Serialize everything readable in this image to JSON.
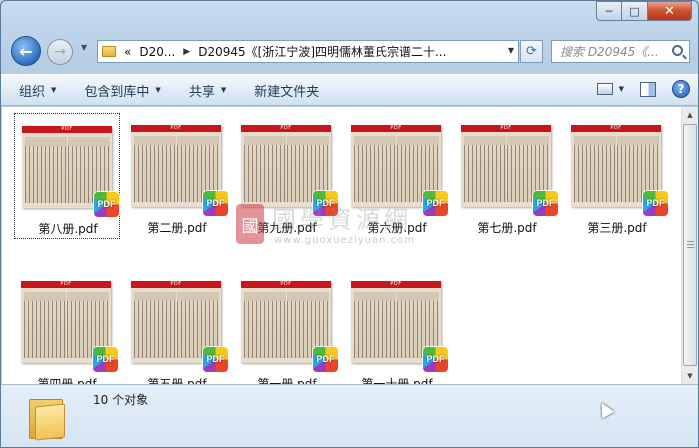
{
  "window": {
    "caption": {
      "minimize": "─",
      "maximize": "□",
      "close": "✕"
    }
  },
  "nav": {
    "back": "←",
    "forward": "→",
    "breadcrumbs": [
      "D20...",
      "D20945《[浙江宁波]四明儒林董氏宗谱二十..."
    ],
    "breadcrumb_prefix": "«",
    "search_placeholder": "搜索 D20945《...",
    "refresh": "⟳"
  },
  "toolbar": {
    "items": [
      "组织",
      "包含到库中",
      "共享",
      "新建文件夹"
    ],
    "help": "?"
  },
  "files": [
    {
      "name": "第八册.pdf",
      "selected": true
    },
    {
      "name": "第二册.pdf"
    },
    {
      "name": "第九册.pdf"
    },
    {
      "name": "第六册.pdf"
    },
    {
      "name": "第七册.pdf"
    },
    {
      "name": "第三册.pdf"
    },
    {
      "name": "第四册.pdf"
    },
    {
      "name": "第五册.pdf"
    },
    {
      "name": "第一册.pdf"
    },
    {
      "name": "第一十册.pdf"
    }
  ],
  "thumb_header": "PDF",
  "badge_label": "PDF",
  "watermark": {
    "logo": "國",
    "title": "國學資源網",
    "url": "www.guoxueziyuan.com"
  },
  "status": {
    "text": "10 个对象"
  }
}
